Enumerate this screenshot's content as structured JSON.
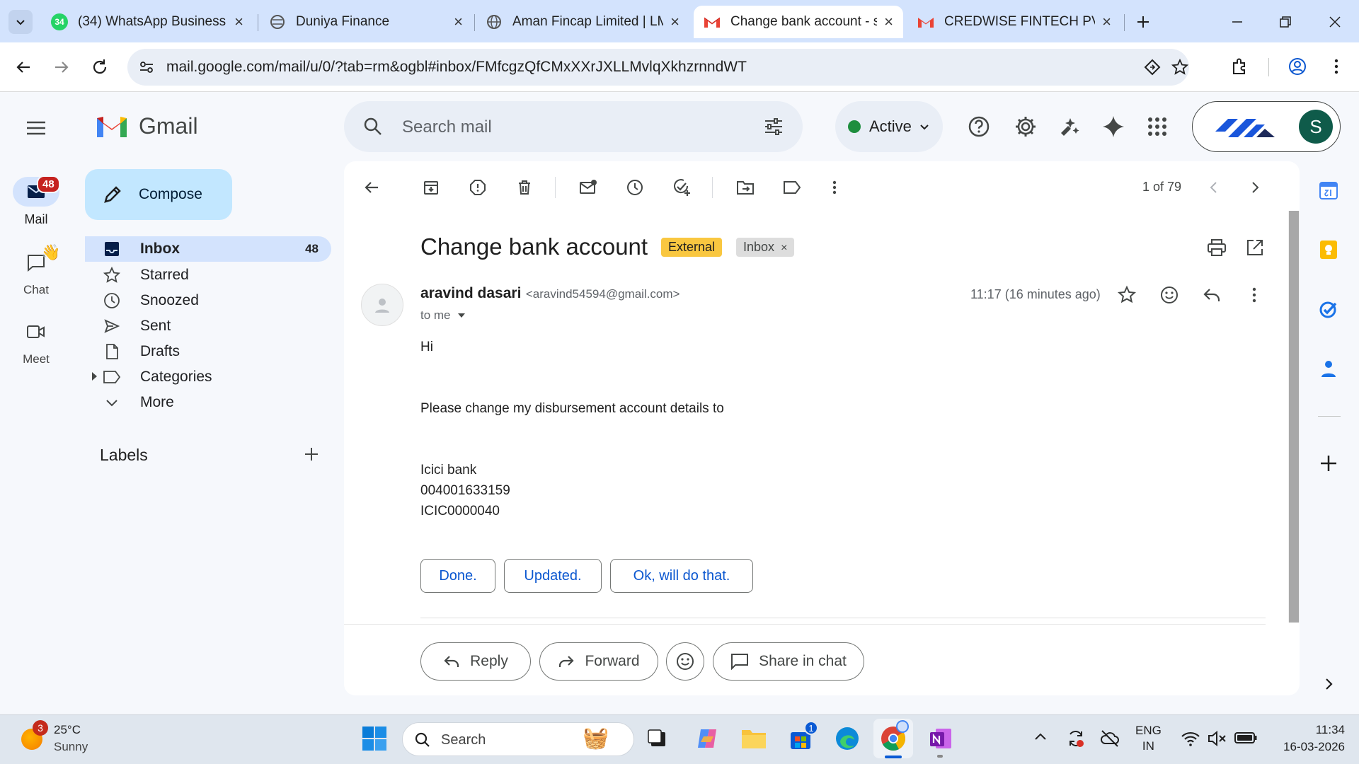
{
  "browser": {
    "tabs": [
      {
        "title": "(34) WhatsApp Business",
        "badge": "34"
      },
      {
        "title": "Duniya Finance"
      },
      {
        "title": "Aman Fincap Limited | LM"
      },
      {
        "title": "Change bank account - s"
      },
      {
        "title": "CREDWISE FINTECH PVT."
      }
    ],
    "url": "mail.google.com/mail/u/0/?tab=rm&ogbl#inbox/FMfcgzQfCMxXXrJXLLMvlqXkhzrnndWT"
  },
  "gmail": {
    "brand": "Gmail",
    "rail": {
      "mail_label": "Mail",
      "mail_badge": "48",
      "chat_label": "Chat",
      "meet_label": "Meet"
    },
    "compose_label": "Compose",
    "search_placeholder": "Search mail",
    "status_label": "Active",
    "avatar_letter": "S",
    "nav": [
      {
        "label": "Inbox",
        "count": "48"
      },
      {
        "label": "Starred"
      },
      {
        "label": "Snoozed"
      },
      {
        "label": "Sent"
      },
      {
        "label": "Drafts"
      },
      {
        "label": "Categories"
      },
      {
        "label": "More"
      }
    ],
    "labels_heading": "Labels",
    "pager": "1 of 79",
    "email": {
      "subject": "Change bank account",
      "chip_external": "External",
      "chip_inbox": "Inbox",
      "chip_inbox_close": "×",
      "sender_name": "aravind dasari",
      "sender_email": "<aravind54594@gmail.com>",
      "to": "to me",
      "time": "11:17 (16 minutes ago)",
      "body": {
        "greeting": "Hi",
        "line1": "Please change my disbursement account details to",
        "bank": "Icici bank",
        "account": "004001633159",
        "ifsc": "ICIC0000040"
      },
      "smart_replies": [
        "Done.",
        "Updated.",
        "Ok, will do that."
      ],
      "actions": {
        "reply": "Reply",
        "forward": "Forward",
        "share": "Share in chat"
      }
    }
  },
  "taskbar": {
    "weather_temp": "25°C",
    "weather_desc": "Sunny",
    "weather_badge": "3",
    "search_label": "Search",
    "store_badge": "1",
    "lang_line1": "ENG",
    "lang_line2": "IN",
    "time": "11:34",
    "date": "16-03-2026"
  },
  "colors": {
    "accent_blue": "#0b57d0",
    "external_chip": "#f9c740",
    "active_green": "#1e8e3e",
    "badge_red": "#c5221f"
  }
}
